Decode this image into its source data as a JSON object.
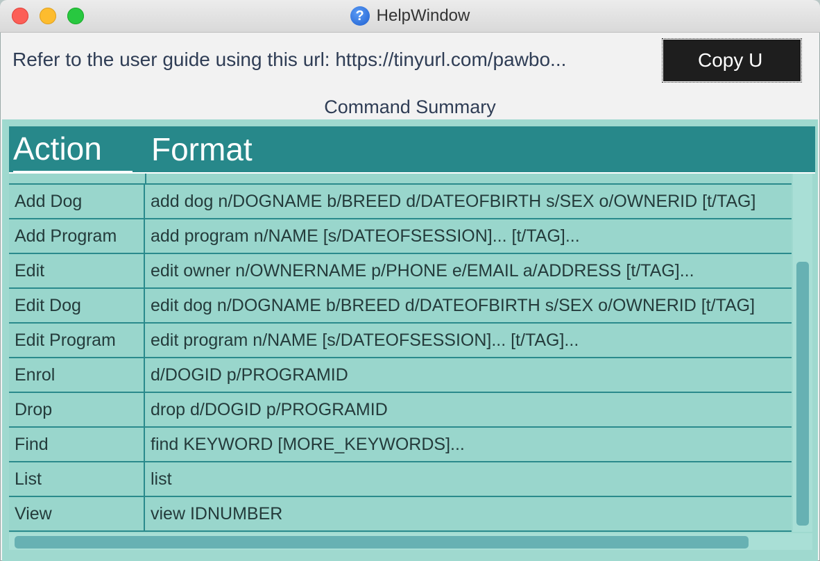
{
  "window": {
    "title": "HelpWindow",
    "help_icon": "question-mark-icon"
  },
  "help": {
    "message": "Refer to the user guide using this url: https://tinyurl.com/pawbo...",
    "copy_label": "Copy U"
  },
  "summary": {
    "title": "Command Summary",
    "columns": [
      "Action",
      "Format"
    ],
    "rows": [
      {
        "action": "Add Dog",
        "format": "add dog n/DOGNAME b/BREED d/DATEOFBIRTH s/SEX o/OWNERID [t/TAG]"
      },
      {
        "action": "Add Program",
        "format": "add program n/NAME [s/DATEOFSESSION]... [t/TAG]..."
      },
      {
        "action": "Edit",
        "format": "edit owner n/OWNERNAME p/PHONE e/EMAIL a/ADDRESS [t/TAG]..."
      },
      {
        "action": "Edit Dog",
        "format": "edit dog n/DOGNAME b/BREED d/DATEOFBIRTH s/SEX o/OWNERID [t/TAG]"
      },
      {
        "action": "Edit Program",
        "format": "edit program n/NAME [s/DATEOFSESSION]... [t/TAG]..."
      },
      {
        "action": "Enrol",
        "format": "d/DOGID p/PROGRAMID"
      },
      {
        "action": "Drop",
        "format": "drop d/DOGID p/PROGRAMID"
      },
      {
        "action": "Find",
        "format": "find KEYWORD [MORE_KEYWORDS]..."
      },
      {
        "action": "List",
        "format": "list"
      },
      {
        "action": "View",
        "format": "view IDNUMBER"
      }
    ]
  },
  "colors": {
    "header_bg": "#27888a",
    "table_bg": "#9fd9cf",
    "button_bg": "#1e1e1e",
    "scroll_thumb": "#67b1b3"
  }
}
